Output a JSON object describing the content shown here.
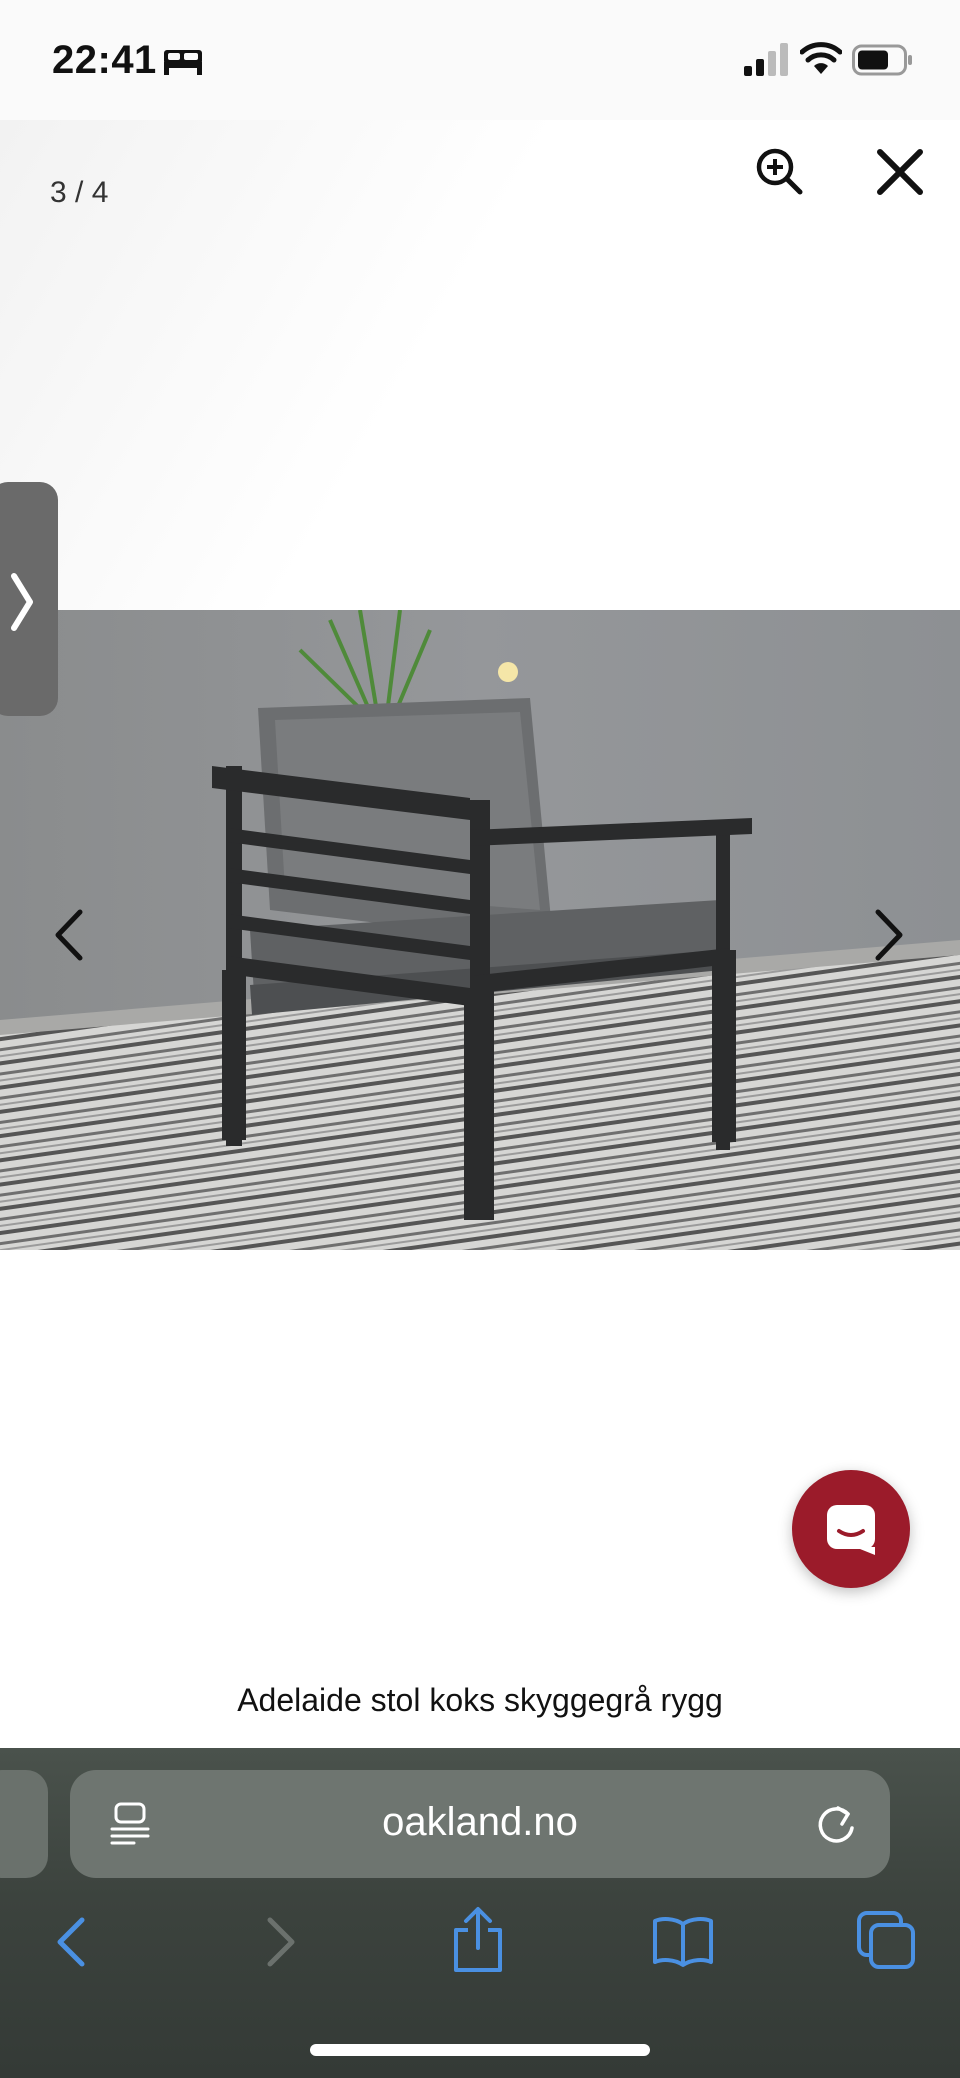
{
  "status_bar": {
    "time": "22:41",
    "icons": [
      "bed-icon",
      "signal-icon",
      "wifi-icon",
      "battery-icon"
    ]
  },
  "viewer": {
    "counter": "3 / 4",
    "zoom_icon": "zoom-in-icon",
    "close_icon": "close-icon",
    "prev_icon": "chevron-left-icon",
    "next_icon": "chevron-right-icon",
    "side_handle_icon": "chevron-right-icon",
    "caption": "Adelaide stol koks skyggegrå rygg"
  },
  "chat": {
    "icon": "chat-bubble-icon",
    "color": "#9b1b2a"
  },
  "browser": {
    "url": "oakland.no",
    "reader_icon": "reader-mode-icon",
    "reload_icon": "reload-icon",
    "toolbar": [
      "back-icon",
      "forward-icon",
      "share-icon",
      "bookmarks-icon",
      "tabs-icon"
    ],
    "accent_color": "#4a90e2"
  }
}
